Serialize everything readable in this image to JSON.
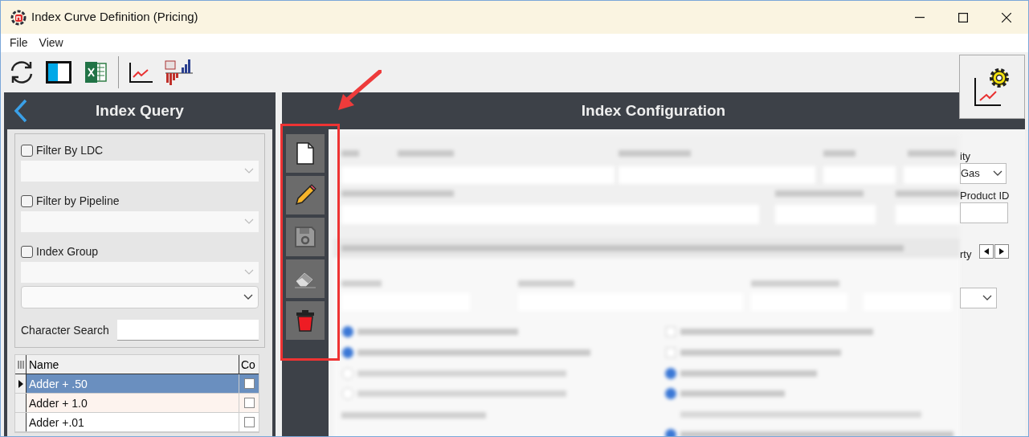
{
  "window": {
    "title": "Index Curve Definition (Pricing)"
  },
  "menu": [
    "File",
    "View"
  ],
  "left_panel": {
    "title": "Index Query",
    "filters": [
      {
        "label": "Filter By LDC",
        "checked": false
      },
      {
        "label": "Filter by Pipeline",
        "checked": false
      },
      {
        "label": "Index Group",
        "checked": false
      }
    ],
    "character_search": {
      "label": "Character Search"
    },
    "grid": {
      "columns": [
        "Name",
        "Co"
      ],
      "rows": [
        {
          "name": "Adder + .50",
          "checked": false,
          "selected": true
        },
        {
          "name": "Adder + 1.0",
          "checked": false,
          "selected": false
        },
        {
          "name": "Adder +.01",
          "checked": false,
          "selected": false
        }
      ]
    }
  },
  "right_panel": {
    "title": "Index Configuration",
    "visible_fragments": {
      "commodity_label": "ity",
      "commodity_value": "Gas",
      "product_label": "Product ID",
      "tab_fragment": "rty"
    }
  }
}
